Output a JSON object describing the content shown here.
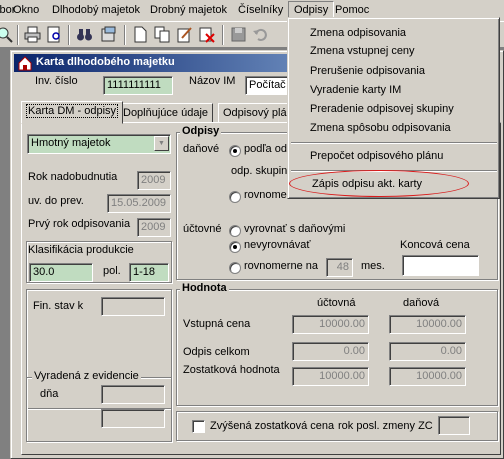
{
  "menubar": {
    "items": [
      "Súbor",
      "Okno",
      "Dlhodobý majetok",
      "Drobný majetok",
      "Číselníky",
      "Odpisy",
      "Pomoc"
    ]
  },
  "window": {
    "title": "Karta dlhodobého majetku"
  },
  "header": {
    "inv_label": "Inv. číslo",
    "inv_value": "1111111111",
    "name_label": "Názov IM",
    "name_value": "Počítač"
  },
  "tabs": [
    "Karta DM - odpisy",
    "Doplňujúce údaje",
    "Odpisový plán"
  ],
  "left": {
    "type_value": "Hmotný majetok",
    "rok_nadobudnutia_label": "Rok nadobudnutia",
    "rok_nadobudnutia_value": "2009",
    "uv_do_prev_label": "uv. do prev.",
    "uv_do_prev_value": "15.05.2009",
    "prvy_rok_label": "Prvý rok odpisovania",
    "prvy_rok_value": "2009",
    "klasifikacia_label": "Klasifikácia produkcie",
    "klasifikacia_value": "30.0",
    "pol_label": "pol.",
    "pol_value": "1-18",
    "fin_stav_label": "Fin. stav k",
    "vyradena_title": "Vyradená z evidencie",
    "dna_label": "dňa"
  },
  "odpisy": {
    "title": "Odpisy",
    "danove_label": "daňové",
    "podla_label": "podľa od",
    "odp_skupin_label": "odp. skupin",
    "rovnomerne_label": "rovnomerne",
    "uctovne_label": "účtovné",
    "vyrovnat_label": "vyrovnať s daňovými",
    "nevyrovnavat_label": "nevyrovnávať",
    "rovnomerne_na_label": "rovnomerne na",
    "months_value": "48",
    "mes_label": "mes.",
    "koncova_cena_label": "Koncová cena"
  },
  "hodnota": {
    "title": "Hodnota",
    "col_uctovna": "účtovná",
    "col_danova": "daňová",
    "rows": [
      {
        "label": "Vstupná cena",
        "uctovna": "10000.00",
        "danova": "10000.00"
      },
      {
        "label": "Odpis celkom",
        "uctovna": "0.00",
        "danova": "0.00"
      },
      {
        "label": "Zostatková hodnota",
        "uctovna": "10000.00",
        "danova": "10000.00"
      }
    ]
  },
  "bottom": {
    "zvysena_label": "Zvýšená zostatková cena",
    "rok_posl_label": "rok posl. zmeny ZC"
  },
  "odpisy_menu": {
    "items": [
      "Zmena odpisovania",
      "Zmena vstupnej ceny",
      "Prerušenie odpisovania",
      "Vyradenie karty IM",
      "Preradenie odpisovej skupiny",
      "Zmena spôsobu odpisovania",
      "Prepočet odpisového plánu",
      "Zápis odpisu akt. karty"
    ]
  },
  "colors": {
    "title_start": "#0a246a",
    "title_end": "#a6caf0",
    "field_green": "#c0dcc0",
    "highlight": "#d81c1c"
  }
}
